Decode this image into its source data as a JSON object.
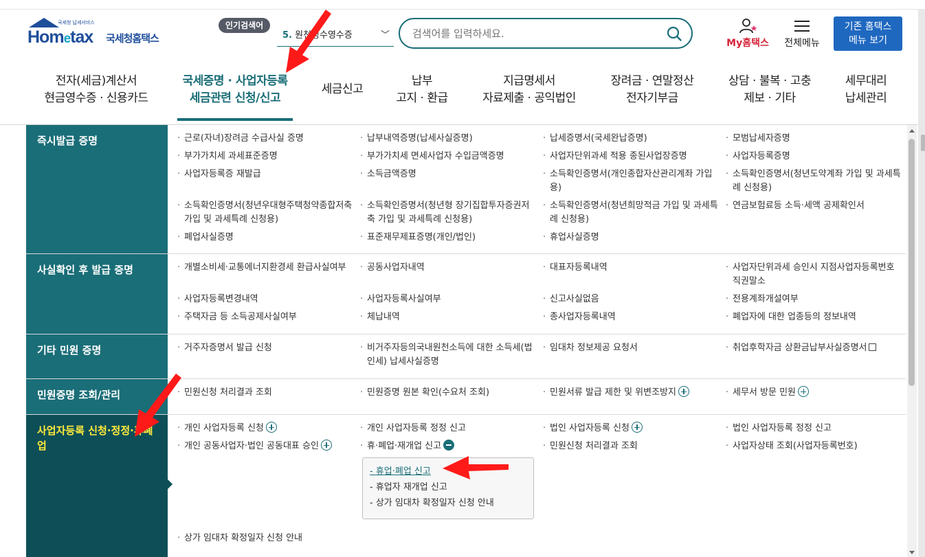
{
  "logo": {
    "small": "국세청 납세서비스",
    "main_a": "Hom",
    "main_e": "e",
    "main_b": "tax",
    "kr": "국세청홈택스"
  },
  "popular": {
    "badge": "인기검색어",
    "num": "5.",
    "text": "원천징수영수증"
  },
  "search": {
    "placeholder": "검색어를 입력하세요."
  },
  "utility": {
    "myhome_prefix": "My",
    "myhome_suffix": "홈택스",
    "allmenu": "전체메뉴",
    "oldhome_line1": "기존 홈택스",
    "oldhome_line2": "메뉴 보기"
  },
  "gnb": [
    {
      "l1": "전자(세금)계산서",
      "l2": "현금영수증 · 신용카드"
    },
    {
      "l1": "국세증명 · 사업자등록",
      "l2": "세금관련 신청/신고"
    },
    {
      "l1": "세금신고",
      "l2": ""
    },
    {
      "l1": "납부",
      "l2": "고지 · 환급"
    },
    {
      "l1": "지급명세서",
      "l2": "자료제출 · 공익법인"
    },
    {
      "l1": "장려금 · 연말정산",
      "l2": "전자기부금"
    },
    {
      "l1": "상담 · 불복 · 고충",
      "l2": "제보 · 기타"
    },
    {
      "l1": "세무대리",
      "l2": "납세관리"
    }
  ],
  "sections": {
    "s1": {
      "title": "즉시발급 증명",
      "items": [
        "근로(자녀)장려금 수급사실 증명",
        "납부내역증명(납세사실증명)",
        "납세증명서(국세완납증명)",
        "모범납세자증명",
        "부가가치세 과세표준증명",
        "부가가치세 면세사업자 수입금액증명",
        "사업자단위과세 적용 종된사업장증명",
        "사업자등록증명",
        "사업자등록증 재발급",
        "소득금액증명",
        "소득확인증명서(개인종합자산관리계좌 가입용)",
        "소득확인증명서(청년도약계좌 가입 및 과세특례 신청용)",
        "소득확인증명서(청년우대형주택청약종합저축 가입 및 과세특례 신청용)",
        "소득확인증명서(청년형 장기집합투자증권저축 가입 및 과세특례 신청용)",
        "소득확인증명서(청년희망적금 가입 및 과세특례 신청용)",
        "연금보험료등 소득·세액 공제확인서",
        "폐업사실증명",
        "표준재무제표증명(개인/법인)",
        "휴업사실증명"
      ]
    },
    "s2": {
      "title": "사실확인 후 발급 증명",
      "items": [
        "개별소비세·교통에너지환경세 환급사실여부",
        "공동사업자내역",
        "대표자등록내역",
        "사업자단위과세 승인시 지점사업자등록번호 직권말소",
        "사업자등록변경내역",
        "사업자등록사실여부",
        "신고사실없음",
        "전용계좌개설여부",
        "주택자금 등 소득공제사실여부",
        "체납내역",
        "총사업자등록내역",
        "폐업자에 대한 업종등의 정보내역"
      ]
    },
    "s3": {
      "title": "기타 민원 증명",
      "items": [
        "거주자증명서 발급 신청",
        "비거주자등의국내원천소득에 대한 소득세(법인세) 납세사실증명",
        "임대차 정보제공 요청서",
        "취업후학자금 상환금납부사실증명서"
      ]
    },
    "s4": {
      "title": "민원증명 조회/관리",
      "items": [
        "민원신청 처리결과 조회",
        "민원증명 원본 확인(수요처 조회)",
        "민원서류 발급 제한 및 위변조방지",
        "세무서 방문 민원"
      ]
    },
    "s5": {
      "title": "사업자등록 신청·정정·휴폐업",
      "items": [
        "개인 사업자등록 신청",
        "개인 사업자등록 정정 신고",
        "법인 사업자등록 신청",
        "법인 사업자등록 정정 신고",
        "개인 공동사업자·법인 공동대표 승인",
        "휴·폐업·재개업 신고",
        "민원신청 처리결과 조회",
        "사업자상태 조회(사업자등록번호)"
      ],
      "sub": [
        "휴업·폐업 신고",
        "휴업자 재개업 신고",
        "상가 임대차 확정일자 신청 안내"
      ],
      "last": "상가 임대차 확정일자 신청 안내"
    }
  }
}
